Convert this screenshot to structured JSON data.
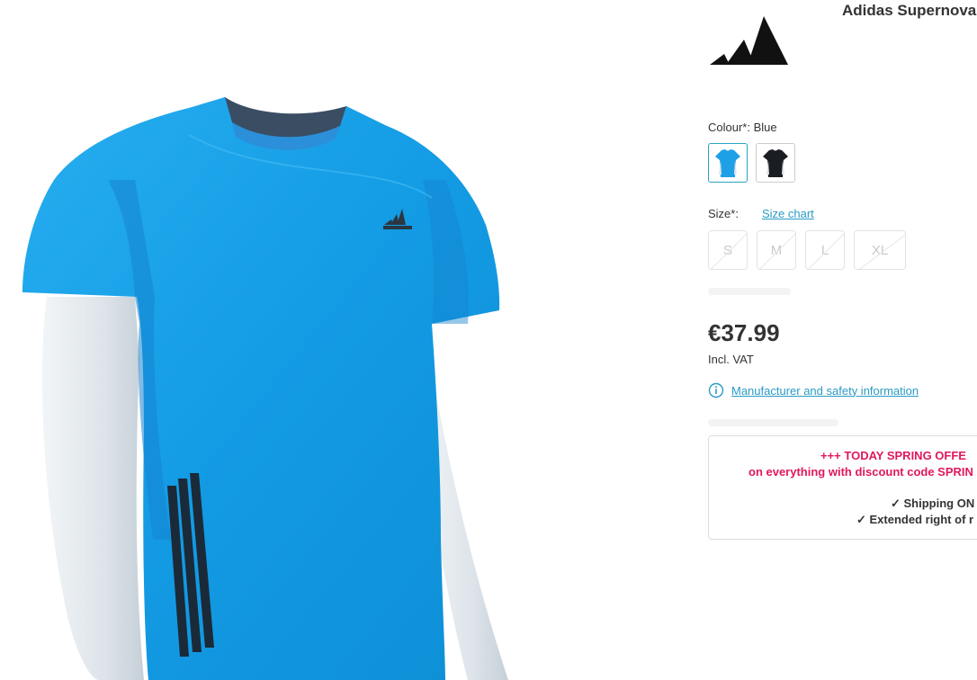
{
  "product": {
    "title": "Adidas Supernova",
    "brand_logo": "adidas-performance-logo",
    "image": "blue-tshirt-on-mannequin"
  },
  "colour": {
    "label": "Colour*:",
    "selected": "Blue",
    "swatches": [
      "Blue",
      "Black"
    ]
  },
  "size": {
    "label": "Size*:",
    "chart_link": "Size chart",
    "options": [
      "S",
      "M",
      "L",
      "XL"
    ],
    "availability": "unavailable"
  },
  "price": {
    "amount": "€37.99",
    "vat_note": "Incl. VAT"
  },
  "safety": {
    "icon": "info-icon",
    "link": "Manufacturer and safety information"
  },
  "promo": {
    "line1": "+++   TODAY SPRING OFFE",
    "line2": "on everything with discount code SPRIN",
    "line3": "✓ Shipping ON",
    "line4": "✓ Extended right of r"
  },
  "colors": {
    "link": "#2a9bc4",
    "promo_pink": "#e0175f",
    "shirt_blue": "#1ea0e6",
    "text": "#333333"
  }
}
